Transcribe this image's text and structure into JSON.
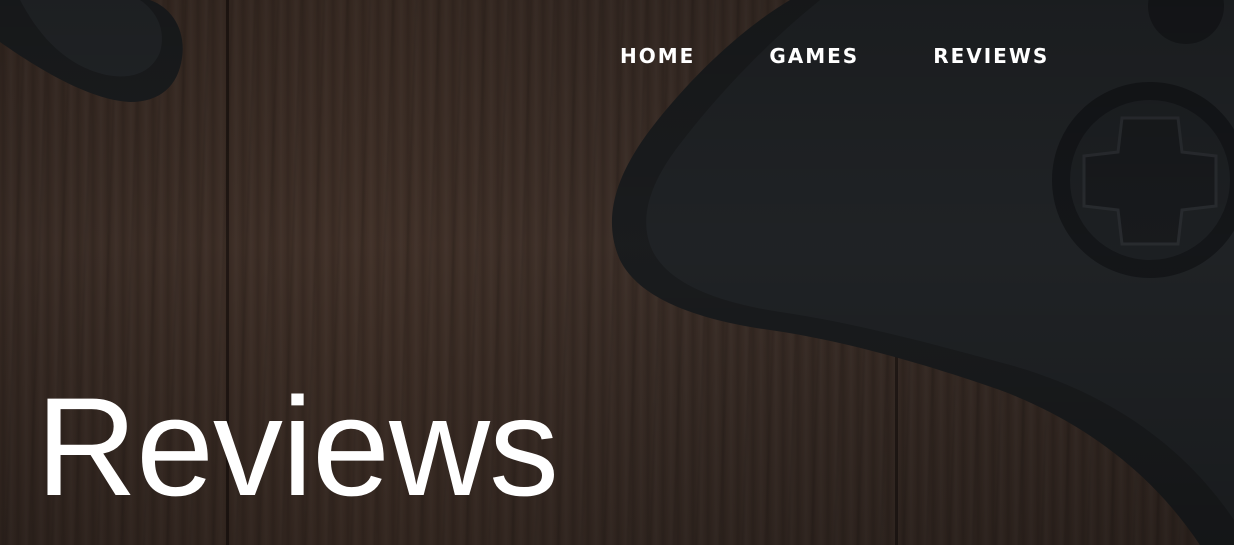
{
  "nav": {
    "items": [
      {
        "label": "HOME"
      },
      {
        "label": "GAMES"
      },
      {
        "label": "REVIEWS"
      }
    ]
  },
  "hero": {
    "title": "Reviews"
  },
  "colors": {
    "text": "#ffffff",
    "wood": "#3b2e27",
    "controller": "#1b1d1f"
  },
  "background": {
    "icon": "gamepad-icon"
  }
}
